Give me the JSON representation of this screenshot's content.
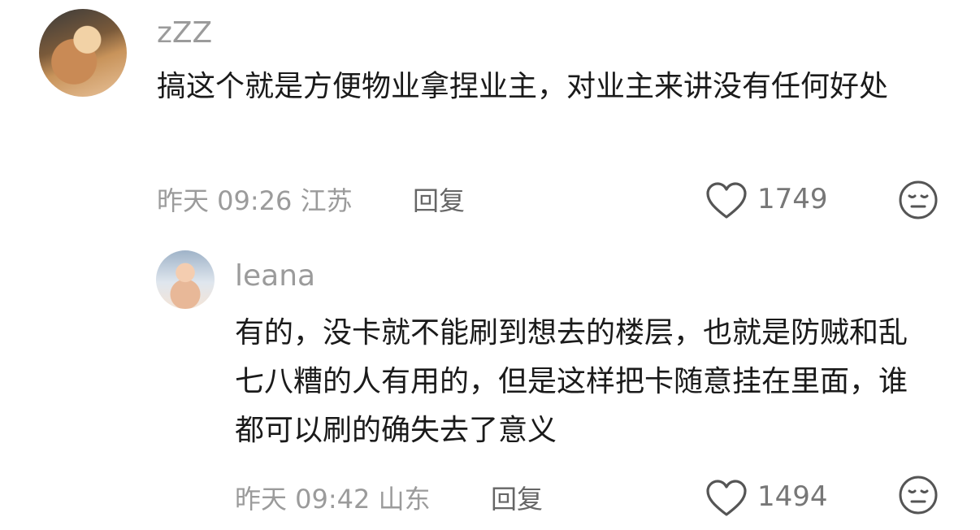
{
  "comments": [
    {
      "username": "zZZ",
      "text": "搞这个就是方便物业拿捏业主，对业主来讲没有任何好处",
      "meta": "昨天 09:26 江苏",
      "reply_label": "回复",
      "likes": "1749",
      "avatar_icon": "shiba-dog-avatar",
      "dislike_icon": "meh-face-icon"
    },
    {
      "username": "leana",
      "text": "有的，没卡就不能刷到想去的楼层，也就是防贼和乱七八糟的人有用的，但是这样把卡随意挂在里面，谁都可以刷的确失去了意义",
      "meta": "昨天 09:42 山东",
      "reply_label": "回复",
      "likes": "1494",
      "avatar_icon": "baby-avatar",
      "dislike_icon": "meh-face-icon"
    }
  ],
  "colors": {
    "text": "#1a1a1a",
    "muted": "#9b9b9b",
    "icon": "#666666"
  }
}
